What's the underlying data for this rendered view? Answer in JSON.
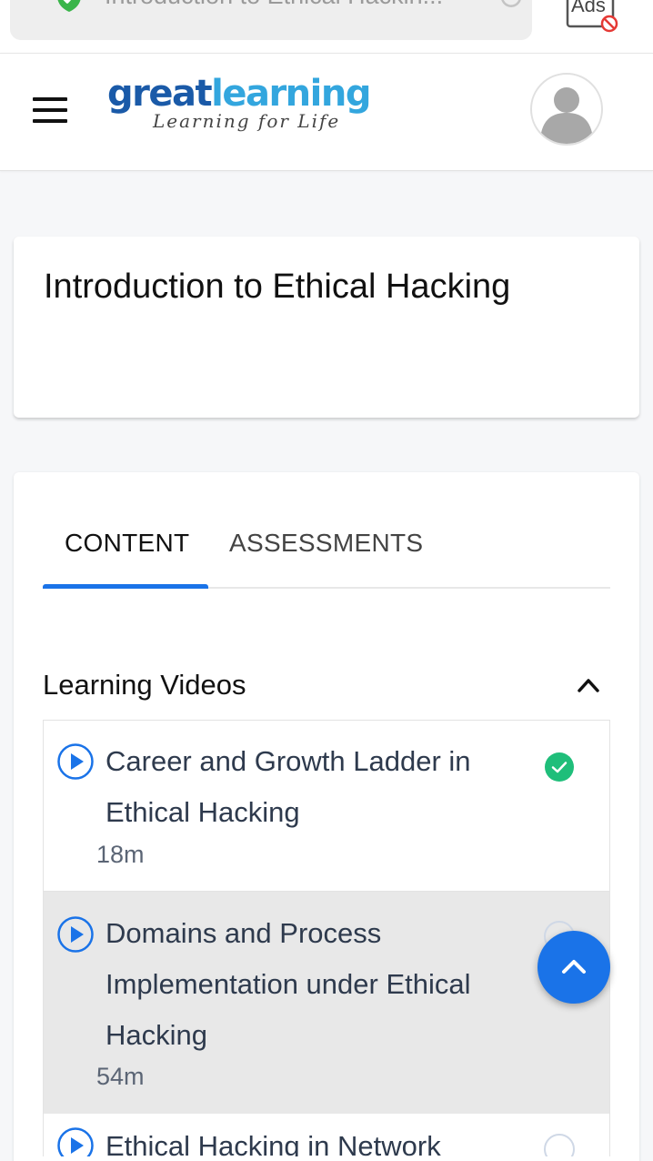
{
  "browser": {
    "url_title": "Introduction to Ethical Hackin...",
    "ads_label": "Ads"
  },
  "header": {
    "logo_part1": "great",
    "logo_part2": "learning",
    "logo_tagline": "Learning for Life"
  },
  "course": {
    "title": "Introduction to Ethical Hacking"
  },
  "tabs": [
    {
      "label": "CONTENT",
      "active": true
    },
    {
      "label": "ASSESSMENTS",
      "active": false
    }
  ],
  "section": {
    "title": "Learning Videos",
    "expanded": true
  },
  "videos": [
    {
      "title": "Career and Growth Ladder in Ethical Hacking",
      "duration": "18m",
      "completed": true
    },
    {
      "title": "Domains and Process Implementation under Ethical Hacking",
      "duration": "54m",
      "completed": false
    },
    {
      "title": "Ethical Hacking in Network",
      "duration": "",
      "completed": false
    }
  ],
  "colors": {
    "accent": "#1a73e8",
    "logo_dark": "#1a5aa8",
    "logo_light": "#33a6de",
    "complete": "#1fbe7a",
    "shield": "#3ab54a"
  }
}
